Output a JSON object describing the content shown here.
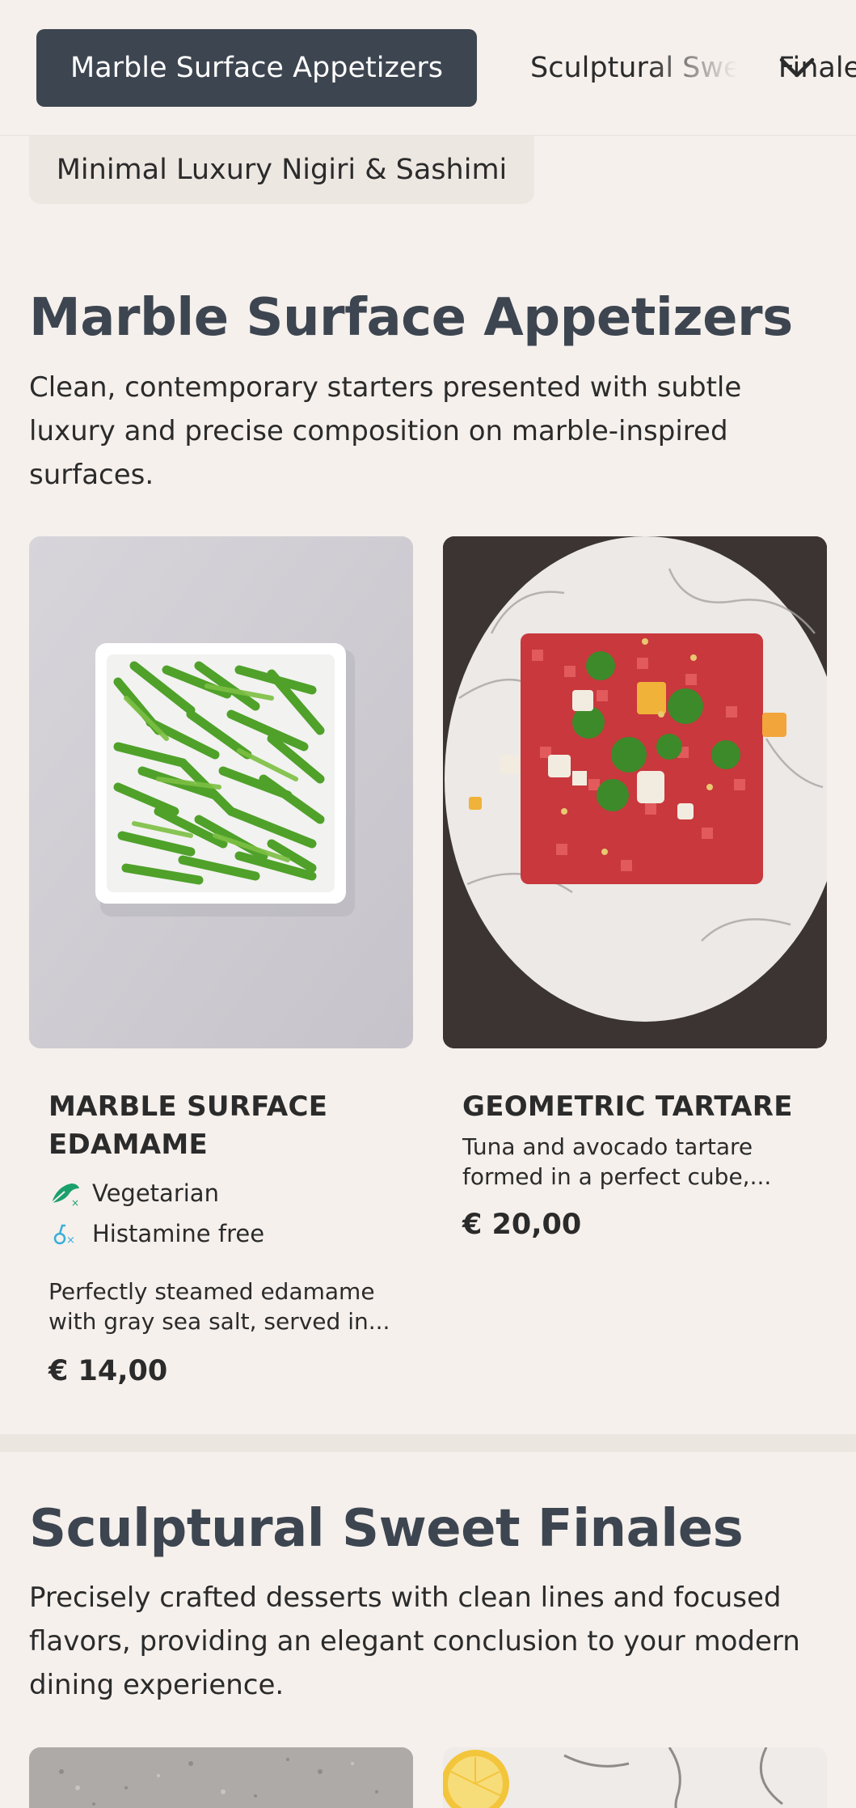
{
  "nav": {
    "active_category": "Marble Surface Appetizers",
    "next_category": "Sculptural Sweet Finales",
    "second_row_category": "Minimal Luxury Nigiri & Sashimi",
    "expand_icon": "chevron-down-icon"
  },
  "sections": [
    {
      "title": "Marble Surface Appetizers",
      "description": "Clean, contemporary starters presented with subtle luxury and precise composition on marble-inspired surfaces.",
      "items": [
        {
          "name": "MARBLE SURFACE EDAMAME",
          "tags": [
            {
              "label": "Vegetarian",
              "icon": "vegetarian-icon",
              "color": "#1aa06b"
            },
            {
              "label": "Histamine free",
              "icon": "histamine-free-icon",
              "color": "#3aaed8"
            }
          ],
          "description": "Perfectly steamed edamame with gray sea salt, served in...",
          "price": "€ 14,00",
          "image": "edamame-in-square-white-bowl"
        },
        {
          "name": "GEOMETRIC TARTARE",
          "tags": [],
          "description": "Tuna and avocado tartare formed in a perfect cube,...",
          "price": "€ 20,00",
          "image": "cube-tuna-tartare-on-marble-plate"
        }
      ]
    },
    {
      "title": "Sculptural Sweet Finales",
      "description": "Precisely crafted desserts with clean lines and focused flavors, providing an elegant conclusion to your modern dining experience."
    }
  ],
  "colors": {
    "background": "#f5f0ec",
    "active_pill": "#3d4550",
    "heading": "#3d4550"
  }
}
